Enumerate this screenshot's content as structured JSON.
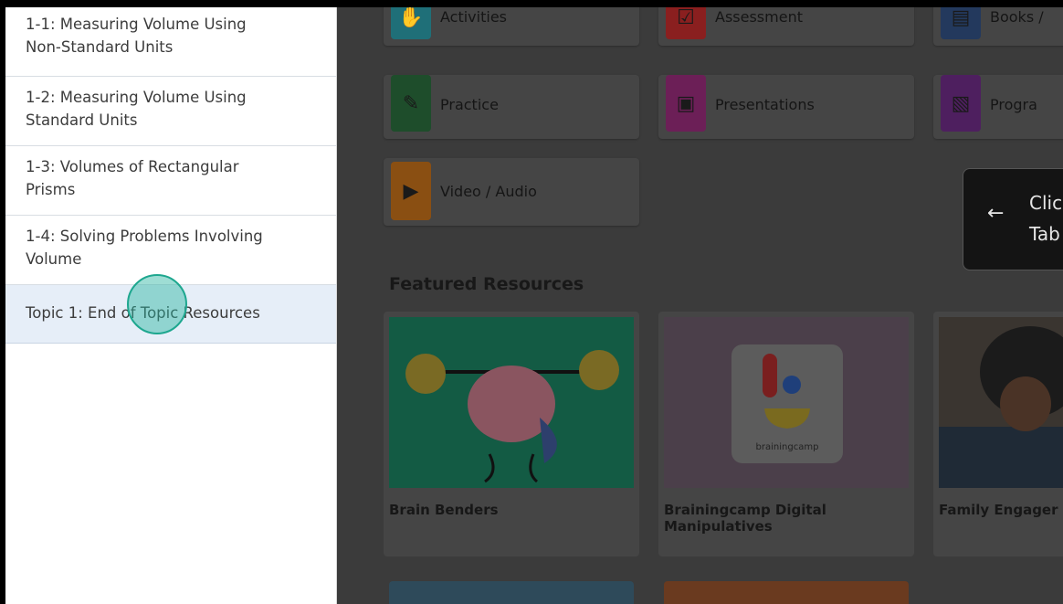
{
  "sidebar": {
    "items": [
      {
        "line1": "1-1: Measuring Volume Using",
        "line2": "Non-Standard Units"
      },
      {
        "line1": "1-2: Measuring Volume Using",
        "line2": "Standard Units"
      },
      {
        "line1": "1-3: Volumes of Rectangular",
        "line2": "Prisms"
      },
      {
        "line1": "1-4: Solving Problems Involving",
        "line2": "Volume"
      },
      {
        "line1": "Topic 1: End of Topic Resources",
        "line2": ""
      }
    ]
  },
  "categories": {
    "activities": "Activities",
    "assessment": "Assessment",
    "books": "Books /",
    "practice": "Practice",
    "presentations": "Presentations",
    "programs": "Progra",
    "video_audio": "Video / Audio"
  },
  "tooltip": {
    "line1": "Clic",
    "line2": "Tab"
  },
  "featured": {
    "heading": "Featured Resources",
    "cards": [
      {
        "title": "Brain Benders"
      },
      {
        "title_line1": "Brainingcamp Digital",
        "title_line2": "Manipulatives",
        "logo_text": "brainingcamp"
      },
      {
        "title": "Family Engager"
      }
    ]
  },
  "colors": {
    "activities": "#1f6f78",
    "assessment": "#8a1f1f",
    "books": "#23395d",
    "practice": "#1e4d2b",
    "presentations": "#6c1f57",
    "programs": "#4e1f5f",
    "video_audio": "#8a4f12",
    "highlight": "#1ea78f"
  }
}
